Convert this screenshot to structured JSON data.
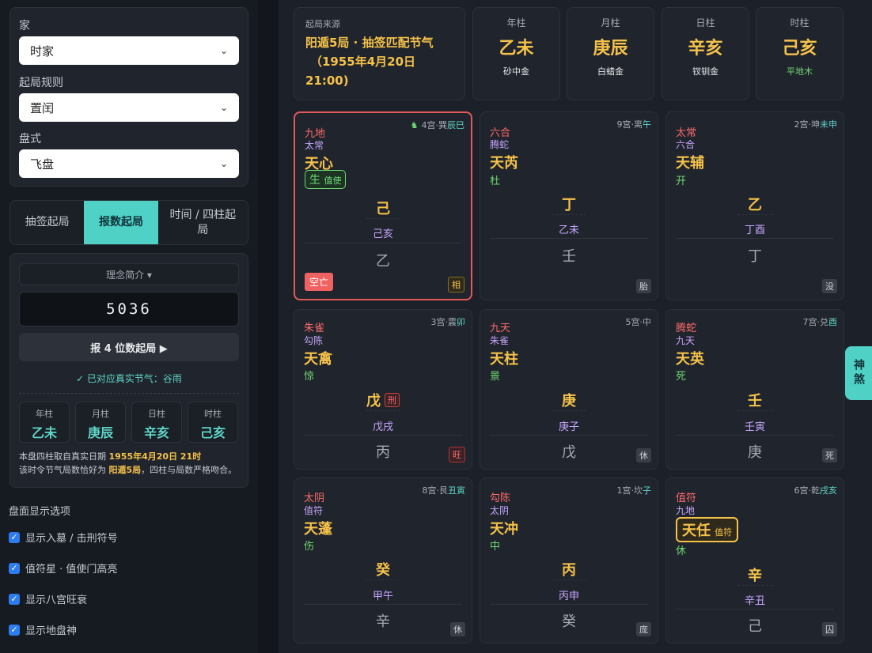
{
  "sidebar": {
    "family_label": "家",
    "family_value": "时家",
    "rule_label": "起局规则",
    "rule_value": "置闰",
    "pan_label": "盘式",
    "pan_value": "飞盘",
    "tabs": [
      "抽签起局",
      "报数起局",
      "时间 / 四柱起局"
    ],
    "concept_label": "理念简介 ▾",
    "number_value": "5036",
    "submit_label": "报 4 位数起局 ▶",
    "match_text": "✓ 已对应真实节气：谷雨",
    "pillars": [
      {
        "t": "年柱",
        "v": "乙未"
      },
      {
        "t": "月柱",
        "v": "庚辰"
      },
      {
        "t": "日柱",
        "v": "辛亥"
      },
      {
        "t": "时柱",
        "v": "己亥"
      }
    ],
    "note1_pre": "本盘四柱取自真实日期",
    "note1_hl": "1955年4月20日 21时",
    "note2_pre": "该时令节气局数恰好为",
    "note2_hl": "阳遁5局",
    "note2_post": "，四柱与局数严格吻合。",
    "options_title": "盘面显示选项",
    "options": [
      "显示入墓 / 击刑符号",
      "值符星 · 值使门高亮",
      "显示八宫旺衰",
      "显示地盘神"
    ]
  },
  "header": {
    "source_label": "起局来源",
    "source_text": "阳遁5局 · 抽签匹配节气（1955年4月20日 21:00)",
    "source_line1": "阳遁5局 · 抽签匹配节气",
    "source_line2": "（1955年4月20日",
    "source_line3": "21:00)",
    "pillars": [
      {
        "t": "年柱",
        "v": "乙未",
        "s": "砂中金"
      },
      {
        "t": "月柱",
        "v": "庚辰",
        "s": "白蜡金"
      },
      {
        "t": "日柱",
        "v": "辛亥",
        "s": "钗钏金"
      },
      {
        "t": "时柱",
        "v": "己亥",
        "s": "平地木"
      }
    ]
  },
  "shensha_tab": "神煞",
  "palaces": [
    {
      "pos": "4宫·巽",
      "branch": "辰巳",
      "god1": "九地",
      "god2": "太常",
      "star": "天心",
      "door": "生",
      "door_tag": "值使",
      "stem": "己",
      "gz": "己亥",
      "ground": "乙",
      "state": "相",
      "empty": "空亡",
      "horse": "♞"
    },
    {
      "pos": "9宫·离",
      "branch": "午",
      "god1": "六合",
      "god2": "腾蛇",
      "star": "天芮",
      "door": "杜",
      "stem": "丁",
      "gz": "乙未",
      "ground": "壬",
      "state": "胎"
    },
    {
      "pos": "2宫·坤",
      "branch": "未申",
      "god1": "太常",
      "god2": "六合",
      "star": "天辅",
      "door": "开",
      "stem": "乙",
      "gz": "丁酉",
      "ground": "丁",
      "state": "没"
    },
    {
      "pos": "3宫·震",
      "branch": "卯",
      "god1": "朱雀",
      "god2": "勾陈",
      "star": "天禽",
      "door": "惊",
      "stem": "戊",
      "stem_tag": "刑",
      "gz": "戊戌",
      "ground": "丙",
      "state": "旺"
    },
    {
      "pos": "5宫·中",
      "branch": "",
      "god1": "九天",
      "god2": "朱雀",
      "star": "天柱",
      "door": "景",
      "stem": "庚",
      "gz": "庚子",
      "ground": "戊",
      "state": "休"
    },
    {
      "pos": "7宫·兑",
      "branch": "酉",
      "god1": "腾蛇",
      "god2": "九天",
      "star": "天英",
      "door": "死",
      "stem": "壬",
      "gz": "壬寅",
      "ground": "庚",
      "state": "死"
    },
    {
      "pos": "8宫·艮",
      "branch": "丑寅",
      "god1": "太阴",
      "god2": "值符",
      "star": "天蓬",
      "door": "伤",
      "stem": "癸",
      "gz": "甲午",
      "ground": "辛",
      "state": "休"
    },
    {
      "pos": "1宫·坎",
      "branch": "子",
      "god1": "勾陈",
      "god2": "太阴",
      "star": "天冲",
      "door": "中",
      "stem": "丙",
      "gz": "丙申",
      "ground": "癸",
      "state": "庞"
    },
    {
      "pos": "6宫·乾",
      "branch": "戌亥",
      "god1": "值符",
      "god2": "九地",
      "star": "天任",
      "star_tag": "值符",
      "door": "休",
      "stem": "辛",
      "gz": "辛丑",
      "ground": "己",
      "state": "囚"
    }
  ],
  "colors": {
    "accent": "#4fd1c5",
    "gold": "#f5c24a",
    "red": "#ff6b6b",
    "purple": "#c7a6ff",
    "green": "#6fd873"
  }
}
